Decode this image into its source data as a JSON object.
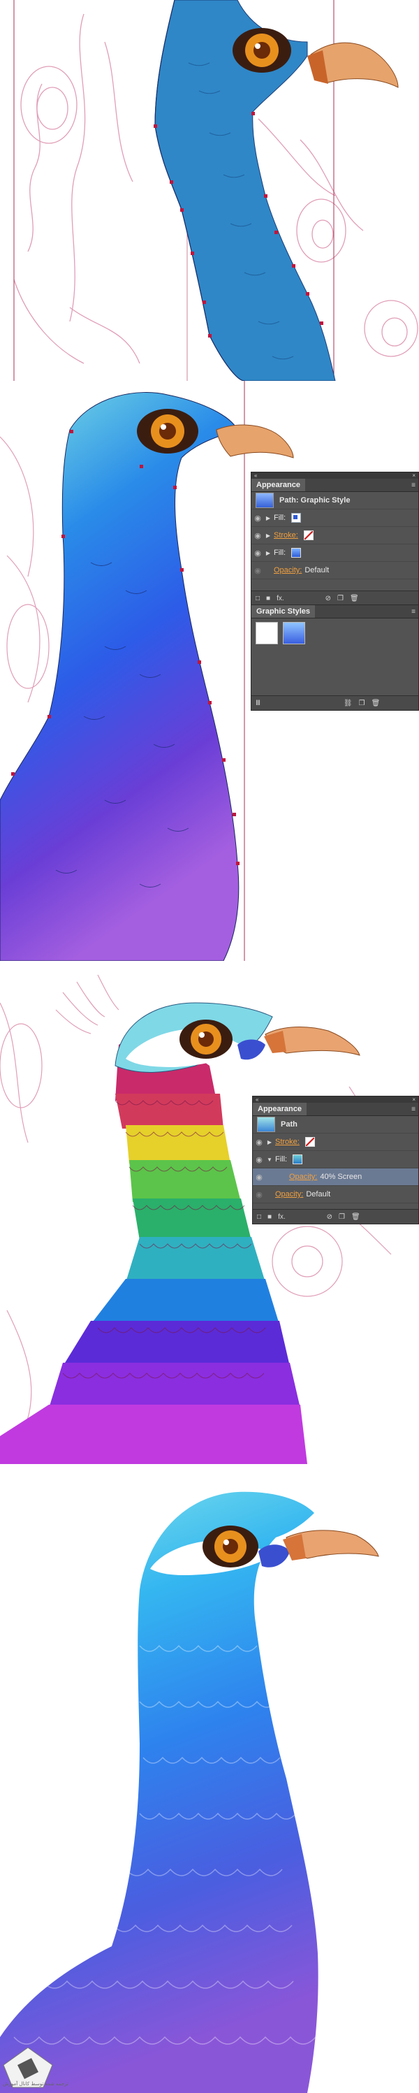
{
  "stages": [
    {
      "id": "stage-1",
      "caption": ""
    },
    {
      "id": "stage-2",
      "caption": ""
    },
    {
      "id": "stage-3",
      "caption": ""
    },
    {
      "id": "stage-4",
      "caption": ""
    }
  ],
  "panel1": {
    "title": "Appearance",
    "object_label": "Path: Graphic Style",
    "rows": [
      {
        "label": "Fill:",
        "type": "fill"
      },
      {
        "label": "Stroke:",
        "type": "stroke"
      },
      {
        "label": "Fill:",
        "type": "fill"
      },
      {
        "label": "Opacity:",
        "value": "Default"
      }
    ],
    "fx_label": "fx."
  },
  "panel_graphic_styles": {
    "title": "Graphic Styles"
  },
  "panel2": {
    "title": "Appearance",
    "object_label": "Path",
    "rows": [
      {
        "label": "Stroke:"
      },
      {
        "label": "Fill:"
      },
      {
        "label": "Opacity:",
        "value": "40% Screen"
      },
      {
        "label": "Opacity:",
        "value": "Default"
      }
    ],
    "fx_label": "fx."
  },
  "colors": {
    "panel_bg": "#535353",
    "accent_link": "#f0a040",
    "sketch": "#d86a9a",
    "selection": "#c0143c"
  },
  "watermark_text": "ترجمه شده توسط کانال آموزش"
}
